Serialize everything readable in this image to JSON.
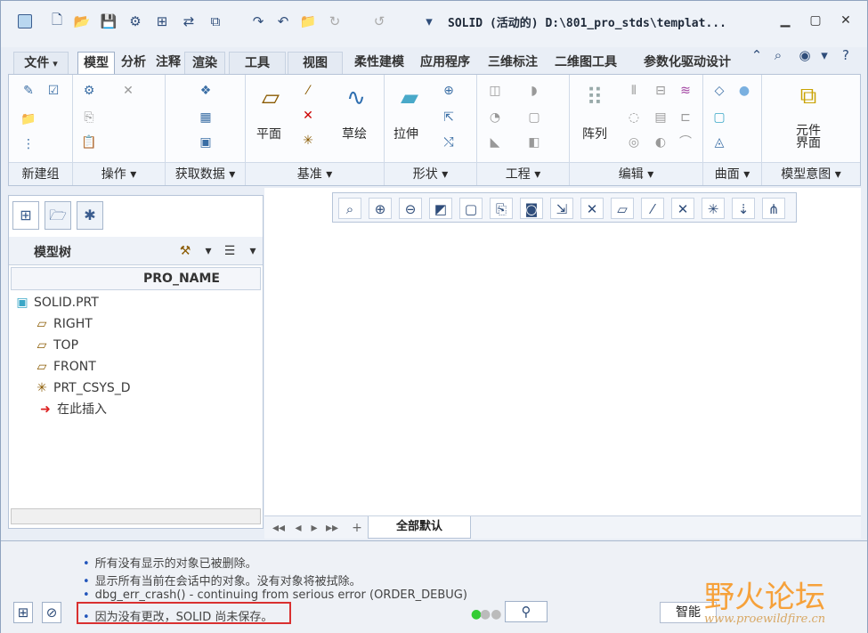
{
  "window": {
    "title": "SOLID (活动的) D:\\801_pro_stds\\templat..."
  },
  "quick_access": {
    "icons": [
      "app-icon",
      "new-icon",
      "open-icon",
      "save-icon",
      "regenerate-icon",
      "properties-icon",
      "replace-icon",
      "window-icon",
      "redo-icon",
      "undo-icon"
    ]
  },
  "menu_tabs": [
    {
      "label": "文件",
      "dropdown": "▾"
    },
    {
      "label": "模型"
    },
    {
      "label": "分析"
    },
    {
      "label": "注释"
    },
    {
      "label": "渲染"
    },
    {
      "label": "工具"
    },
    {
      "label": "视图"
    },
    {
      "label": "柔性建模"
    },
    {
      "label": "应用程序"
    },
    {
      "label": "三维标注"
    },
    {
      "label": "二维图工具"
    },
    {
      "label": "参数化驱动设计"
    }
  ],
  "ribbon": {
    "groups": [
      {
        "label": "新建组"
      },
      {
        "label": "操作 ▾"
      },
      {
        "label": "获取数据 ▾"
      },
      {
        "label": "基准 ▾"
      },
      {
        "label": "形状 ▾"
      },
      {
        "label": "工程 ▾"
      },
      {
        "label": "编辑 ▾"
      },
      {
        "label": "曲面 ▾"
      },
      {
        "label": "模型意图 ▾"
      }
    ],
    "buttons": {
      "plane": "平面",
      "sketch": "草绘",
      "extrude": "拉伸",
      "pattern": "阵列",
      "component_interface_1": "元件",
      "component_interface_2": "界面"
    }
  },
  "model_tree": {
    "title": "模型树",
    "column": "PRO_NAME",
    "items": [
      {
        "label": "SOLID.PRT"
      },
      {
        "label": "RIGHT"
      },
      {
        "label": "TOP"
      },
      {
        "label": "FRONT"
      },
      {
        "label": "PRT_CSYS_D"
      },
      {
        "label": "在此插入"
      }
    ]
  },
  "bottom_tab": {
    "label": "全部默认",
    "add": "+"
  },
  "messages": [
    "所有没有显示的对象已被删除。",
    "显示所有当前在会话中的对象。没有对象将被拭除。",
    "dbg_err_crash() - continuing from serious error (ORDER_DEBUG)",
    "因为没有更改，SOLID 尚未保存。"
  ],
  "status": {
    "smart_filter": "智能"
  },
  "watermark": {
    "brand": "野火论坛",
    "url": "www.proewildfire.cn"
  },
  "colors": {
    "accent": "#3b5d8f",
    "highlight_box": "#d93030"
  }
}
